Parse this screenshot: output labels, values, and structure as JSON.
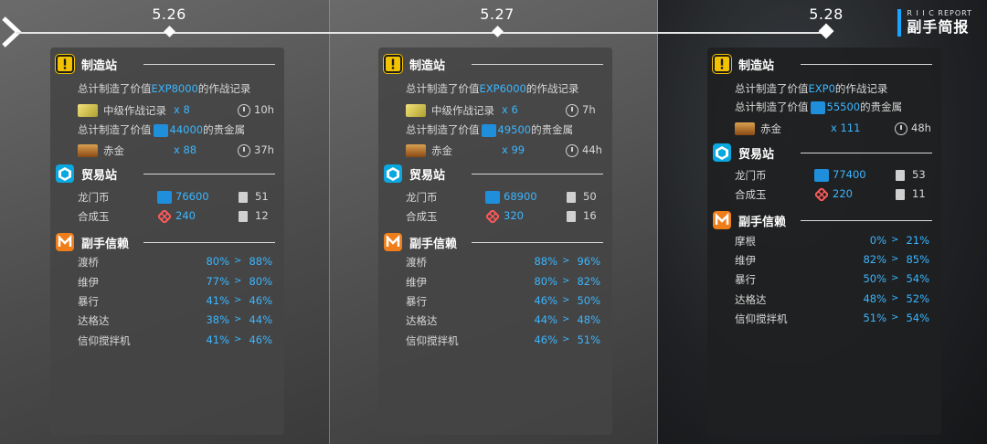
{
  "header": {
    "report_en": "R I I C REPORT",
    "report_zh": "副手简报"
  },
  "timeline": {
    "dates": [
      "5.26",
      "5.27",
      "5.28"
    ]
  },
  "colors": {
    "accent": "#3bb6ff",
    "factory_icon": "#f2c200",
    "trade_icon": "#0aa8e0",
    "trust_icon": "#ef7d19"
  },
  "days": [
    {
      "factory": {
        "title": "制造站",
        "record_line_prefix": "总计制造了价值",
        "record_value": "EXP8000",
        "record_line_suffix": "的作战记录",
        "record_item": "中级作战记录",
        "record_qty": "x 8",
        "record_time": "10h",
        "gold_line_prefix": "总计制造了价值",
        "gold_value": "44000",
        "gold_line_suffix": "的贵金属",
        "gold_item": "赤金",
        "gold_qty": "x 88",
        "gold_time": "37h"
      },
      "trade": {
        "title": "贸易站",
        "lmd_label": "龙门币",
        "lmd_value": "76600",
        "lmd_orders": "51",
        "orundum_label": "合成玉",
        "orundum_value": "240",
        "orundum_orders": "12"
      },
      "trust": {
        "title": "副手信赖",
        "rows": [
          {
            "name": "渡桥",
            "from": "80%",
            "to": "88%"
          },
          {
            "name": "维伊",
            "from": "77%",
            "to": "80%"
          },
          {
            "name": "暴行",
            "from": "41%",
            "to": "46%"
          },
          {
            "name": "达格达",
            "from": "38%",
            "to": "44%"
          },
          {
            "name": "信仰搅拌机",
            "from": "41%",
            "to": "46%"
          }
        ]
      }
    },
    {
      "factory": {
        "title": "制造站",
        "record_line_prefix": "总计制造了价值",
        "record_value": "EXP6000",
        "record_line_suffix": "的作战记录",
        "record_item": "中级作战记录",
        "record_qty": "x 6",
        "record_time": "7h",
        "gold_line_prefix": "总计制造了价值",
        "gold_value": "49500",
        "gold_line_suffix": "的贵金属",
        "gold_item": "赤金",
        "gold_qty": "x 99",
        "gold_time": "44h"
      },
      "trade": {
        "title": "贸易站",
        "lmd_label": "龙门币",
        "lmd_value": "68900",
        "lmd_orders": "50",
        "orundum_label": "合成玉",
        "orundum_value": "320",
        "orundum_orders": "16"
      },
      "trust": {
        "title": "副手信赖",
        "rows": [
          {
            "name": "渡桥",
            "from": "88%",
            "to": "96%"
          },
          {
            "name": "维伊",
            "from": "80%",
            "to": "82%"
          },
          {
            "name": "暴行",
            "from": "46%",
            "to": "50%"
          },
          {
            "name": "达格达",
            "from": "44%",
            "to": "48%"
          },
          {
            "name": "信仰搅拌机",
            "from": "46%",
            "to": "51%"
          }
        ]
      }
    },
    {
      "factory": {
        "title": "制造站",
        "record_line_prefix": "总计制造了价值",
        "record_value": "EXP0",
        "record_line_suffix": "的作战记录",
        "gold_line_prefix": "总计制造了价值",
        "gold_value": "55500",
        "gold_line_suffix": "的贵金属",
        "gold_item": "赤金",
        "gold_qty": "x 111",
        "gold_time": "48h"
      },
      "trade": {
        "title": "贸易站",
        "lmd_label": "龙门币",
        "lmd_value": "77400",
        "lmd_orders": "53",
        "orundum_label": "合成玉",
        "orundum_value": "220",
        "orundum_orders": "11"
      },
      "trust": {
        "title": "副手信赖",
        "rows": [
          {
            "name": "摩根",
            "from": "0%",
            "to": "21%"
          },
          {
            "name": "维伊",
            "from": "82%",
            "to": "85%"
          },
          {
            "name": "暴行",
            "from": "50%",
            "to": "54%"
          },
          {
            "name": "达格达",
            "from": "48%",
            "to": "52%"
          },
          {
            "name": "信仰搅拌机",
            "from": "51%",
            "to": "54%"
          }
        ]
      }
    }
  ]
}
